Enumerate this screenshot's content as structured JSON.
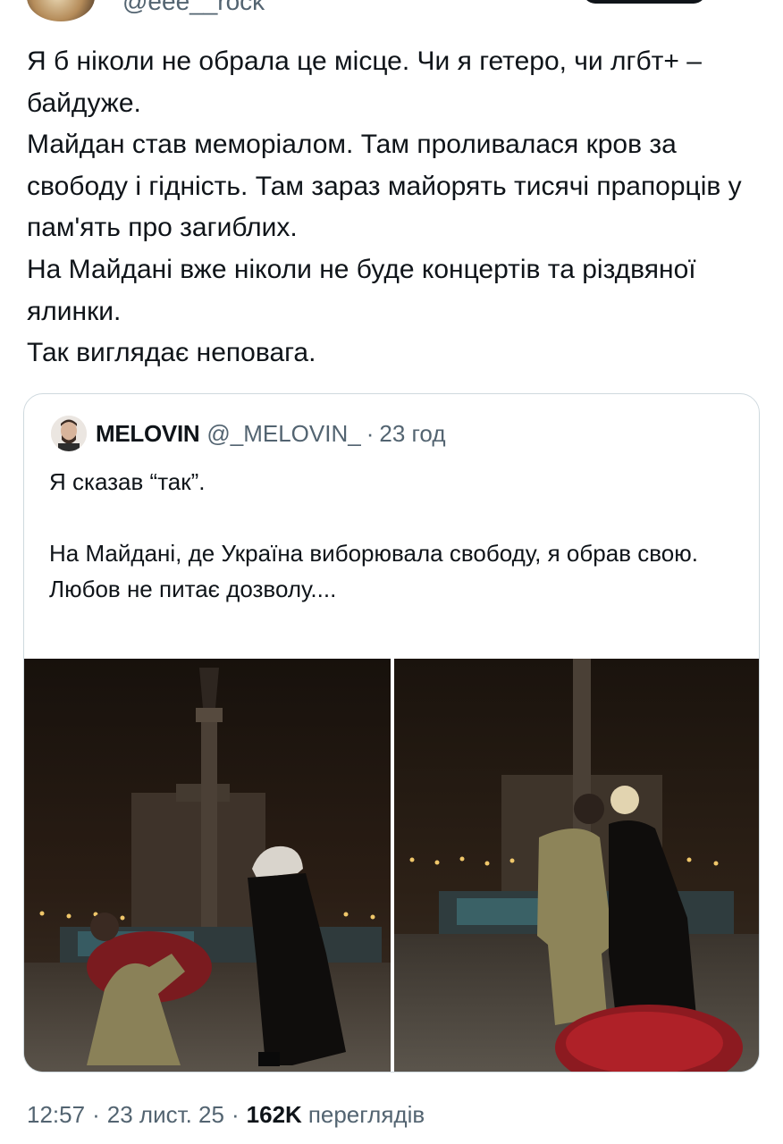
{
  "author": {
    "handle": "@eee__rock"
  },
  "tweet": {
    "paragraphs": [
      "Я б ніколи не обрала це місце. Чи я гетеро, чи лгбт+ – байдуже.",
      "Майдан став меморіалом. Там проливалася кров за свободу і гідність. Там зараз майорять тисячі прапорців у пам'ять про загиблих.",
      "На Майдані вже ніколи не буде концертів та різдвяної ялинки.",
      "Так виглядає неповага."
    ]
  },
  "quote": {
    "name": "MELOVIN",
    "handle": "@_MELOVIN_",
    "dot": "·",
    "time": "23 год",
    "line1": "Я сказав “так”.",
    "line2": "На Майдані, де Україна виборювала свободу, я обрав свою.",
    "line3": "Любов не питає дозволу...."
  },
  "meta": {
    "time": "12:57",
    "dot1": "·",
    "date": "23 лист. 25",
    "dot2": "·",
    "views_count": "162K",
    "views_label": "переглядів"
  },
  "colors": {
    "text": "#0f1419",
    "secondary": "#536471",
    "border": "#cfd9de"
  }
}
